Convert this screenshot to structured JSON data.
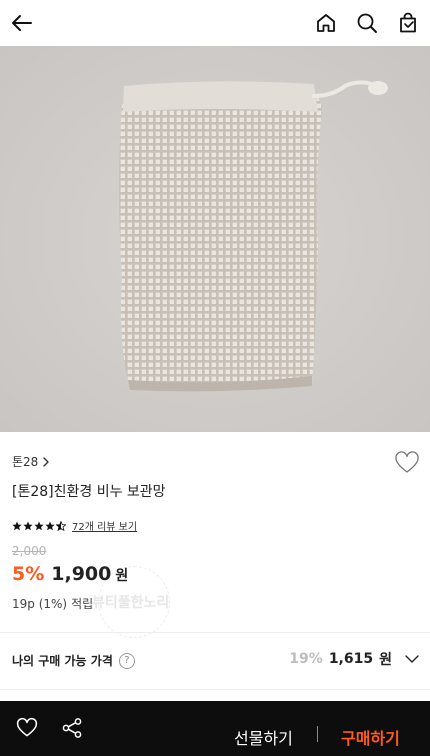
{
  "icons": {
    "back": "arrow-left-icon",
    "home": "home-icon",
    "search": "search-icon",
    "cart": "shopping-bag-icon",
    "wishlist": "heart-outline-icon",
    "share": "share-icon",
    "chevron": "chevron-right-icon",
    "expand": "chevron-down-icon",
    "help": "question-circle-icon"
  },
  "product": {
    "brand": "톤28",
    "name": "[톤28]친환경 비누 보관망",
    "rating": 4.5,
    "review_link": "72개 리뷰 보기",
    "original_price": "2,000",
    "discount": "5%",
    "price": "1,900",
    "currency": "원",
    "points": "19p (1%)",
    "points_label": "적립"
  },
  "watermark": "뷰티풀한노리",
  "purchase": {
    "label": "나의 구매 가능 가격",
    "help_glyph": "?",
    "discount": "19%",
    "price": "1,615",
    "currency": "원"
  },
  "bottom_bar": {
    "gift_label": "선물하기",
    "buy_label": "구매하기"
  },
  "colors": {
    "accent": "#ff5a1f",
    "hero_bg": "#d2cecb",
    "bottom_bar": "#0d0d0d",
    "text": "#222222"
  }
}
